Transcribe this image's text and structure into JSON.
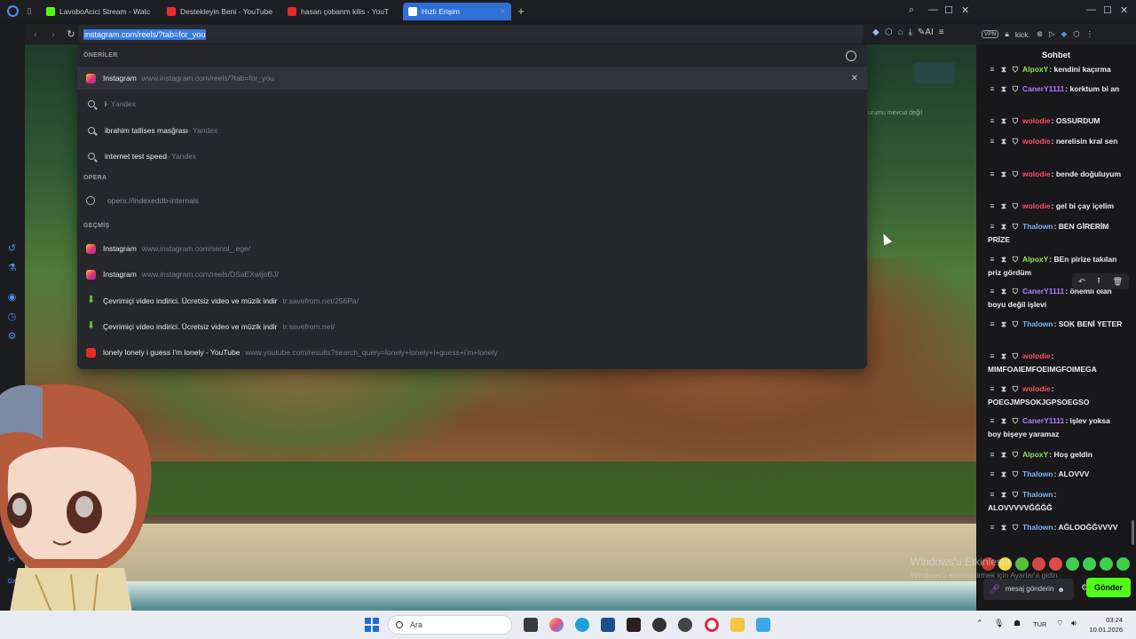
{
  "tabs": [
    {
      "label": "LavoboAcici Stream - Watc",
      "icon_color": "#53fc18"
    },
    {
      "label": "Destekleyin Beni - YouTube",
      "icon_color": "#e52d27"
    },
    {
      "label": "hasan çobanm kilis - YouT",
      "icon_color": "#e52d27"
    },
    {
      "label": "Hızlı Erişim",
      "icon_color": "#ffffff",
      "active": true
    }
  ],
  "address": {
    "url": "instagram.com/reels/?tab=for_you",
    "ai_label": "AI"
  },
  "dropdown": {
    "section_suggestions": "ÖNERİLER",
    "section_opera": "OPERA",
    "section_history": "GEÇMİŞ",
    "top": {
      "title": "Instagram",
      "url": "www.instagram.com/reels/?tab=for_you"
    },
    "searches": [
      {
        "query": "i",
        "engine": " - Yandex"
      },
      {
        "query": "ibrahim tatlises masğrası",
        "engine": " - Yandex"
      },
      {
        "query": "internet test speed",
        "engine": " - Yandex"
      }
    ],
    "opera_item": "opera://indexeddb-internals",
    "history": [
      {
        "title": "Instagram",
        "url": "www.instagram.com/senol_.ege/",
        "icon": "ig"
      },
      {
        "title": "Instagram",
        "url": "www.instagram.com/reels/DSaEXwijoBJ/",
        "icon": "ig"
      },
      {
        "title": "Çevrimiçi video indirici. Ücretsiz video ve müzik indir",
        "url": "tr.savefrom.net/256Pa/",
        "icon": "sf"
      },
      {
        "title": "Çevrimiçi video indirici. Ücretsiz video ve müzik indir",
        "url": "tr.savefrom.net/",
        "icon": "sf"
      },
      {
        "title": "lonely lonely i guess i'm lonely - YouTube",
        "url": "www.youtube.com/results?search_query=lonely+lonely+i+guess+i'm+lonely",
        "icon": "yt"
      }
    ]
  },
  "page": {
    "bg_text": "urumu mevcut değil"
  },
  "chat": {
    "site_label": "kick.",
    "vpn_label": "VPN",
    "title": "Sohbet",
    "messages": [
      {
        "user": "AlpoxY",
        "color": "#8ee55b",
        "text": "kendini kaçırma"
      },
      {
        "user": "CanerY1111",
        "color": "#b07cff",
        "text": "korktum bi an"
      },
      {
        "user": "wolodie",
        "color": "#ff4a6a",
        "text": "OSSURDUM"
      },
      {
        "user": "wolodie",
        "color": "#ff4a6a",
        "text": "nerelisin kral sen"
      },
      {
        "user": "wolodie",
        "color": "#ff4a6a",
        "text": "bende doğuluyum"
      },
      {
        "user": "wolodie",
        "color": "#ff4a6a",
        "text": "gel bi çay içelim"
      },
      {
        "user": "Thalown",
        "color": "#7ab3ff",
        "text": "BEN GİRERİM PRİZE"
      },
      {
        "user": "AlpoxY",
        "color": "#8ee55b",
        "text": "BEn pirize takılan priz gördüm"
      },
      {
        "user": "CanerY1111",
        "color": "#b07cff",
        "text": "önemli olan boyu değil işlevi"
      },
      {
        "user": "Thalown",
        "color": "#7ab3ff",
        "text": "SOK BENİ YETER"
      },
      {
        "user": "wolodie",
        "color": "#ff4a6a",
        "text": "MIMFOAIEMFOEIMGFOIMEGA"
      },
      {
        "user": "wolodie",
        "color": "#ff4a6a",
        "text": "POEGJMPSOKJGPSOEGSO"
      },
      {
        "user": "CanerY1111",
        "color": "#b07cff",
        "text": "işlev yoksa boy bişeye yaramaz"
      },
      {
        "user": "AlpoxY",
        "color": "#8ee55b",
        "text": "Hoş geldin"
      },
      {
        "user": "Thalown",
        "color": "#7ab3ff",
        "text": "ALOVVV"
      },
      {
        "user": "Thalown",
        "color": "#7ab3ff",
        "text": "ALOVVVVVĞĞĞĞ"
      },
      {
        "user": "Thalown",
        "color": "#7ab3ff",
        "text": "AĞLOOĞĞVVVV"
      }
    ],
    "input_placeholder": "mesaj gönderin",
    "send_label": "Gönder",
    "emote_colors": [
      "#c0392b",
      "#f5d742",
      "#55c23a",
      "#d04747",
      "#e24a4a",
      "#3fcf4f",
      "#3fcf4f",
      "#3fcf4f",
      "#3fcf4f"
    ]
  },
  "windows": {
    "activate_title": "Windows'u Etkinleştir",
    "activate_sub": "Windows'u etkinleştirmek için Ayarlar'a gidin."
  },
  "taskbar": {
    "search_label": "Ara",
    "lang": "TUR",
    "time": "03:24",
    "date": "10.01.2026"
  }
}
